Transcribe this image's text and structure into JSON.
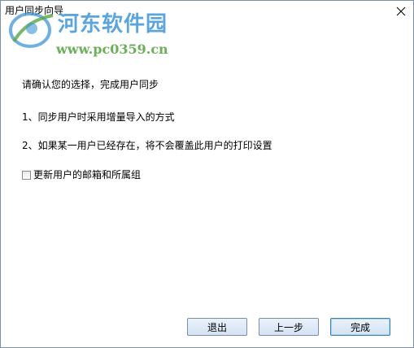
{
  "window": {
    "title": "用户同步向导",
    "close_glyph": "✕"
  },
  "watermark": {
    "site_name": "河东软件园",
    "url": "www.pc0359.cn"
  },
  "content": {
    "heading": "请确认您的选择，完成用户同步",
    "line1": "1、同步用户时采用增量导入的方式",
    "line2": "2、如果某一用户已经存在，将不会覆盖此用户的打印设置"
  },
  "options": {
    "update_mailbox_label": "更新用户的邮箱和所属组",
    "update_mailbox_checked": false
  },
  "buttons": {
    "exit_label": "退出",
    "prev_label": "上一步",
    "finish_label": "完成"
  },
  "colors": {
    "watermark_blue": "#3f95d6",
    "watermark_green": "#5aa845",
    "button_border": "#7b8ea8",
    "default_button_border": "#3c7fb1"
  }
}
